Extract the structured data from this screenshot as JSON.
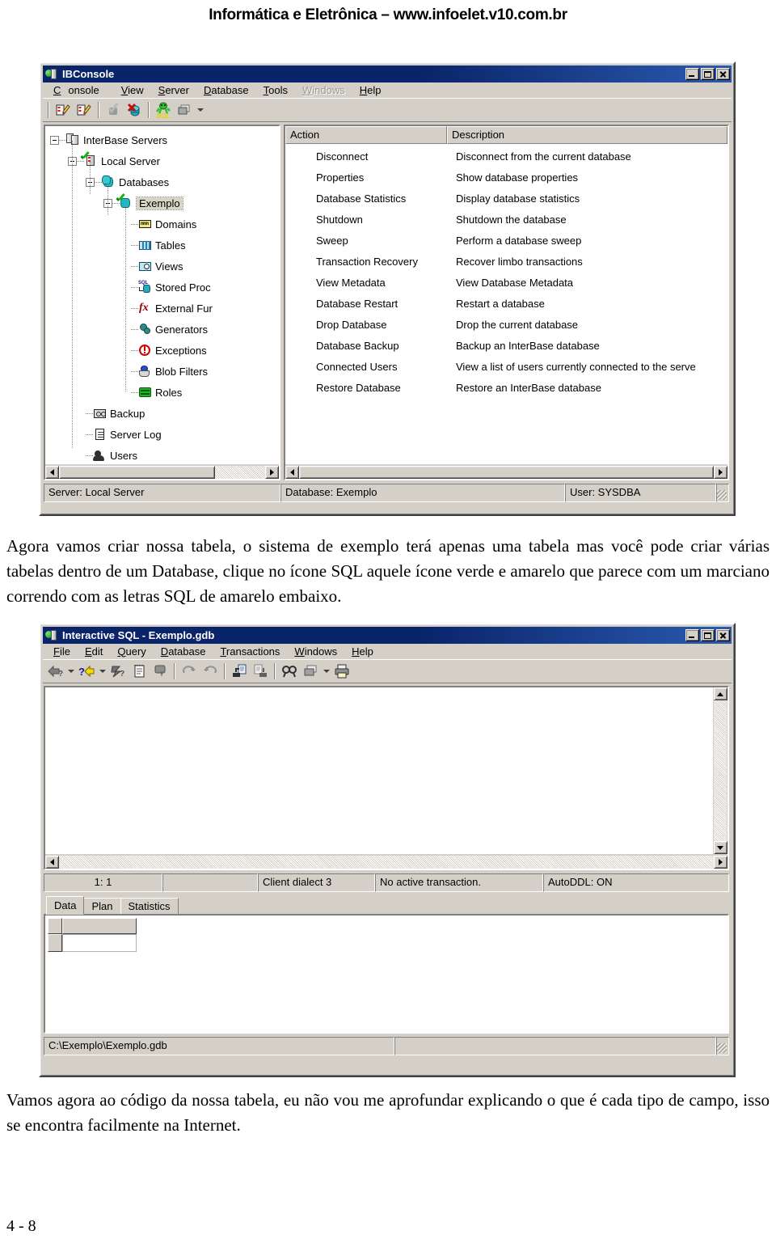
{
  "page": {
    "header": "Informática e Eletrônica – www.infoelet.v10.com.br",
    "page_number": "4 - 8",
    "paragraph_1": "Agora vamos criar nossa tabela, o sistema de exemplo terá apenas uma tabela mas você pode criar várias tabelas dentro de um Database, clique no ícone SQL aquele ícone verde e amarelo que parece com um marciano correndo com as letras SQL de amarelo embaixo.",
    "paragraph_2": "Vamos agora ao código da nossa tabela, eu não vou me aprofundar explicando o que é cada tipo de campo, isso se encontra facilmente na Internet."
  },
  "ibconsole": {
    "title": "IBConsole",
    "menu": [
      {
        "label": "Console",
        "disabled": false
      },
      {
        "label": "View",
        "disabled": false
      },
      {
        "label": "Server",
        "disabled": false
      },
      {
        "label": "Database",
        "disabled": false
      },
      {
        "label": "Tools",
        "disabled": false
      },
      {
        "label": "Windows",
        "disabled": true
      },
      {
        "label": "Help",
        "disabled": false
      }
    ],
    "window_buttons": {
      "minimize": "minimize-button",
      "maximize": "maximize-button",
      "close": "close-button"
    },
    "toolbar_icons": [
      "register-database-icon",
      "unregister-database-icon",
      "connect-database-icon",
      "disconnect-database-icon",
      "interactive-sql-icon",
      "cascade-windows-icon",
      "dropdown-arrow-icon"
    ],
    "tree": [
      {
        "label": "InterBase Servers",
        "indent": 0,
        "icon": "servers-icon",
        "expander": true,
        "check": false,
        "selected": false
      },
      {
        "label": "Local Server",
        "indent": 1,
        "icon": "server-icon",
        "expander": true,
        "check": true,
        "selected": false
      },
      {
        "label": "Databases",
        "indent": 2,
        "icon": "databases-icon",
        "expander": true,
        "check": false,
        "selected": false
      },
      {
        "label": "Exemplo",
        "indent": 3,
        "icon": "database-icon",
        "expander": true,
        "check": true,
        "selected": true
      },
      {
        "label": "Domains",
        "indent": 4,
        "icon": "domains-icon",
        "expander": false,
        "check": false,
        "selected": false
      },
      {
        "label": "Tables",
        "indent": 4,
        "icon": "tables-icon",
        "expander": false,
        "check": false,
        "selected": false
      },
      {
        "label": "Views",
        "indent": 4,
        "icon": "views-icon",
        "expander": false,
        "check": false,
        "selected": false
      },
      {
        "label": "Stored Proc",
        "indent": 4,
        "icon": "stored-procedures-icon",
        "expander": false,
        "check": false,
        "selected": false
      },
      {
        "label": "External Fur",
        "indent": 4,
        "icon": "external-functions-icon",
        "expander": false,
        "check": false,
        "selected": false
      },
      {
        "label": "Generators",
        "indent": 4,
        "icon": "generators-icon",
        "expander": false,
        "check": false,
        "selected": false
      },
      {
        "label": "Exceptions",
        "indent": 4,
        "icon": "exceptions-icon",
        "expander": false,
        "check": false,
        "selected": false
      },
      {
        "label": "Blob Filters",
        "indent": 4,
        "icon": "blob-filters-icon",
        "expander": false,
        "check": false,
        "selected": false
      },
      {
        "label": "Roles",
        "indent": 4,
        "icon": "roles-icon",
        "expander": false,
        "check": false,
        "selected": false
      },
      {
        "label": "Backup",
        "indent": 2,
        "icon": "backup-icon",
        "expander": false,
        "check": false,
        "selected": false
      },
      {
        "label": "Server Log",
        "indent": 2,
        "icon": "server-log-icon",
        "expander": false,
        "check": false,
        "selected": false
      },
      {
        "label": "Users",
        "indent": 2,
        "icon": "users-icon",
        "expander": false,
        "check": false,
        "selected": false
      }
    ],
    "list": {
      "columns": [
        "Action",
        "Description"
      ],
      "rows": [
        [
          "Disconnect",
          "Disconnect from the current database"
        ],
        [
          "Properties",
          "Show database properties"
        ],
        [
          "Database Statistics",
          "Display database statistics"
        ],
        [
          "Shutdown",
          "Shutdown the database"
        ],
        [
          "Sweep",
          "Perform a database sweep"
        ],
        [
          "Transaction Recovery",
          "Recover limbo transactions"
        ],
        [
          "View Metadata",
          "View Database Metadata"
        ],
        [
          "Database Restart",
          "Restart a database"
        ],
        [
          "Drop Database",
          "Drop the current database"
        ],
        [
          "Database Backup",
          "Backup an InterBase database"
        ],
        [
          "Connected Users",
          "View a list of users currently connected to the serve"
        ],
        [
          "Restore Database",
          "Restore an InterBase database"
        ]
      ]
    },
    "status": {
      "server": "Server: Local Server",
      "database": "Database: Exemplo",
      "user": "User: SYSDBA"
    }
  },
  "isql": {
    "title": "Interactive SQL - Exemplo.gdb",
    "menu": [
      {
        "label": "File",
        "disabled": false
      },
      {
        "label": "Edit",
        "disabled": false
      },
      {
        "label": "Query",
        "disabled": false
      },
      {
        "label": "Database",
        "disabled": false
      },
      {
        "label": "Transactions",
        "disabled": false
      },
      {
        "label": "Windows",
        "disabled": false
      },
      {
        "label": "Help",
        "disabled": false
      }
    ],
    "toolbar_icons": [
      "previous-query-icon",
      "previous-query-dropdown-icon",
      "next-query-icon",
      "next-query-dropdown-icon",
      "execute-query-icon",
      "query-plan-icon",
      "save-results-icon",
      "commit-icon",
      "rollback-icon",
      "load-script-icon",
      "save-script-icon",
      "find-icon",
      "cascade-windows-icon",
      "cascade-dropdown-icon",
      "print-icon"
    ],
    "editor_value": "",
    "status": {
      "cursor": "1: 1",
      "blank": "",
      "dialect": "Client dialect 3",
      "transaction": "No active transaction.",
      "autoddl": "AutoDDL: ON"
    },
    "tabs": [
      {
        "label": "Data",
        "active": true
      },
      {
        "label": "Plan",
        "active": false
      },
      {
        "label": "Statistics",
        "active": false
      }
    ],
    "bottom_status": {
      "path": "C:\\Exemplo\\Exemplo.gdb",
      "blank": ""
    }
  },
  "colors": {
    "title_bar": "#0a246a",
    "face": "#d4d0c8",
    "selection": "#d9d5c3"
  }
}
